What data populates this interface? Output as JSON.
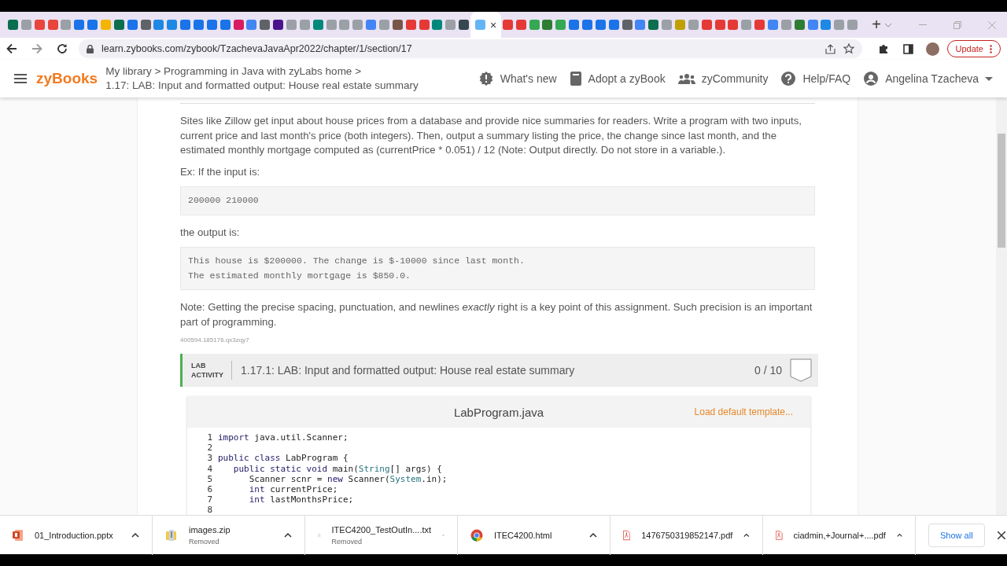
{
  "browser": {
    "tabs": [
      {
        "color": "#0b6e4f",
        "selected": false
      },
      {
        "color": "#9aa0a6",
        "selected": false
      },
      {
        "color": "#e8453c",
        "selected": false
      },
      {
        "color": "#e8453c",
        "selected": false
      },
      {
        "color": "#9aa0a6",
        "selected": false
      },
      {
        "color": "#1a73e8",
        "selected": false
      },
      {
        "color": "#1a73e8",
        "selected": false
      },
      {
        "color": "#f4b400",
        "selected": false
      },
      {
        "color": "#0b6e4f",
        "selected": false
      },
      {
        "color": "#1a73e8",
        "selected": false
      },
      {
        "color": "#5f6368",
        "selected": false
      },
      {
        "color": "#1e88e5",
        "selected": false
      },
      {
        "color": "#1e88e5",
        "selected": false
      },
      {
        "color": "#1a73e8",
        "selected": false
      },
      {
        "color": "#1a73e8",
        "selected": false
      },
      {
        "color": "#1a73e8",
        "selected": false
      },
      {
        "color": "#1a73e8",
        "selected": false
      },
      {
        "color": "#d81b60",
        "selected": false
      },
      {
        "color": "#4285f4",
        "selected": false
      },
      {
        "color": "#5f6368",
        "selected": false
      },
      {
        "color": "#4a148c",
        "selected": false
      },
      {
        "color": "#9aa0a6",
        "selected": false
      },
      {
        "color": "#9aa0a6",
        "selected": false
      },
      {
        "color": "#00897b",
        "selected": false
      },
      {
        "color": "#9aa0a6",
        "selected": false
      },
      {
        "color": "#9aa0a6",
        "selected": false
      },
      {
        "color": "#9aa0a6",
        "selected": false
      },
      {
        "color": "#4285f4",
        "selected": false
      },
      {
        "color": "#9aa0a6",
        "selected": false
      },
      {
        "color": "#795548",
        "selected": false
      },
      {
        "color": "#e53935",
        "selected": false
      },
      {
        "color": "#e53935",
        "selected": false
      },
      {
        "color": "#00897b",
        "selected": false
      },
      {
        "color": "#9aa0a6",
        "selected": false
      },
      {
        "color": "#37474f",
        "selected": false
      },
      {
        "color": "#64b5f6",
        "selected": true
      },
      {
        "color": "#e53935",
        "selected": false
      },
      {
        "color": "#e53935",
        "selected": false
      },
      {
        "color": "#34a853",
        "selected": false
      },
      {
        "color": "#2e7d32",
        "selected": false
      },
      {
        "color": "#34a853",
        "selected": false
      },
      {
        "color": "#1a73e8",
        "selected": false
      },
      {
        "color": "#1a73e8",
        "selected": false
      },
      {
        "color": "#1a73e8",
        "selected": false
      },
      {
        "color": "#1a73e8",
        "selected": false
      },
      {
        "color": "#5f6368",
        "selected": false
      },
      {
        "color": "#4285f4",
        "selected": false
      },
      {
        "color": "#0b6e4f",
        "selected": false
      },
      {
        "color": "#9aa0a6",
        "selected": false
      },
      {
        "color": "#c0a000",
        "selected": false
      },
      {
        "color": "#9aa0a6",
        "selected": false
      },
      {
        "color": "#e53935",
        "selected": false
      },
      {
        "color": "#e53935",
        "selected": false
      },
      {
        "color": "#e53935",
        "selected": false
      },
      {
        "color": "#9aa0a6",
        "selected": false
      },
      {
        "color": "#e53935",
        "selected": false
      },
      {
        "color": "#4285f4",
        "selected": false
      },
      {
        "color": "#9aa0a6",
        "selected": false
      },
      {
        "color": "#2e7d32",
        "selected": false
      },
      {
        "color": "#4285f4",
        "selected": false
      },
      {
        "color": "#1e88e5",
        "selected": false
      },
      {
        "color": "#9aa0a6",
        "selected": false
      },
      {
        "color": "#9aa0a6",
        "selected": false
      }
    ],
    "close": "×",
    "new_tab": "+",
    "url": "learn.zybooks.com/zybook/TzachevaJavaApr2022/chapter/1/section/17",
    "update_button": "Update"
  },
  "header": {
    "logo": "zyBooks",
    "breadcrumb": "My library > Programming in Java with zyLabs home >",
    "section_title": "1.17: LAB: Input and formatted output: House real estate summary",
    "nav": [
      {
        "kind": "news",
        "label": "What's new"
      },
      {
        "kind": "book",
        "label": "Adopt a zyBook"
      },
      {
        "kind": "community",
        "label": "zyCommunity"
      },
      {
        "kind": "help",
        "label": "Help/FAQ"
      },
      {
        "kind": "user",
        "label": "Angelina Tzacheva"
      }
    ]
  },
  "content": {
    "intro": "Sites like Zillow get input about house prices from a database and provide nice summaries for readers. Write a program with two inputs, current price and last month's price (both integers). Then, output a summary listing the price, the change since last month, and the estimated monthly mortgage computed as (currentPrice * 0.051) / 12 (Note: Output directly. Do not store in a variable.).",
    "example_label": "Ex: If the input is:",
    "input_example": "200000 210000",
    "output_label": "the output is:",
    "output_example": [
      "This house is $200000. The change is $-10000 since last month.",
      "The estimated monthly mortgage is $850.0."
    ],
    "note": "Note: Getting the precise spacing, punctuation, and newlines *exactly* right is a key point of this assignment. Such precision is an important part of programming.",
    "id_text": "400594.185176.qx3zqy7"
  },
  "lab": {
    "label_lines": [
      "LAB",
      "ACTIVITY"
    ],
    "title": "1.17.1: LAB: Input and formatted output: House real estate summary",
    "score": "0 / 10",
    "file_name": "LabProgram.java",
    "load_template": "Load default template...",
    "code": [
      {
        "number": "1",
        "segments": [
          {
            "kind": "keyword",
            "text": "import"
          },
          {
            "kind": "plain",
            "text": " java.util.Scanner;"
          }
        ]
      },
      {
        "number": "2"
      },
      {
        "number": "3",
        "segments": [
          {
            "kind": "keyword",
            "text": "public class"
          },
          {
            "kind": "plain",
            "text": " LabProgram {"
          }
        ]
      },
      {
        "number": "4",
        "segments": [
          {
            "kind": "keyword",
            "text": "   public static void"
          },
          {
            "kind": "plain",
            "text": " main("
          },
          {
            "kind": "type",
            "text": "String"
          },
          {
            "kind": "plain",
            "text": "[] args) {"
          }
        ]
      },
      {
        "number": "5",
        "segments": [
          {
            "kind": "plain",
            "text": "      Scanner scnr = "
          },
          {
            "kind": "keyword",
            "text": "new"
          },
          {
            "kind": "plain",
            "text": " Scanner("
          },
          {
            "kind": "type",
            "text": "System"
          },
          {
            "kind": "plain",
            "text": ".in);"
          }
        ]
      },
      {
        "number": "6",
        "segments": [
          {
            "kind": "keyword",
            "text": "      int"
          },
          {
            "kind": "plain",
            "text": " currentPrice;"
          }
        ]
      },
      {
        "number": "7",
        "segments": [
          {
            "kind": "keyword",
            "text": "      int"
          },
          {
            "kind": "plain",
            "text": " lastMonthsPrice;"
          }
        ]
      },
      {
        "number": "8"
      }
    ]
  },
  "downloads": [
    {
      "kind": "pptx",
      "name": "01_Introduction.pptx"
    },
    {
      "kind": "zip",
      "name": "images.zip",
      "status": "Removed"
    },
    {
      "kind": "txt",
      "name": "ITEC4200_TestOutIn....txt",
      "status": "Removed"
    },
    {
      "kind": "html",
      "name": "ITEC4200.html"
    },
    {
      "kind": "pdf",
      "name": "1476750319852147.pdf"
    },
    {
      "kind": "pdf",
      "name": "ciadmin,+Journal+....pdf"
    }
  ],
  "show_all": "Show all"
}
